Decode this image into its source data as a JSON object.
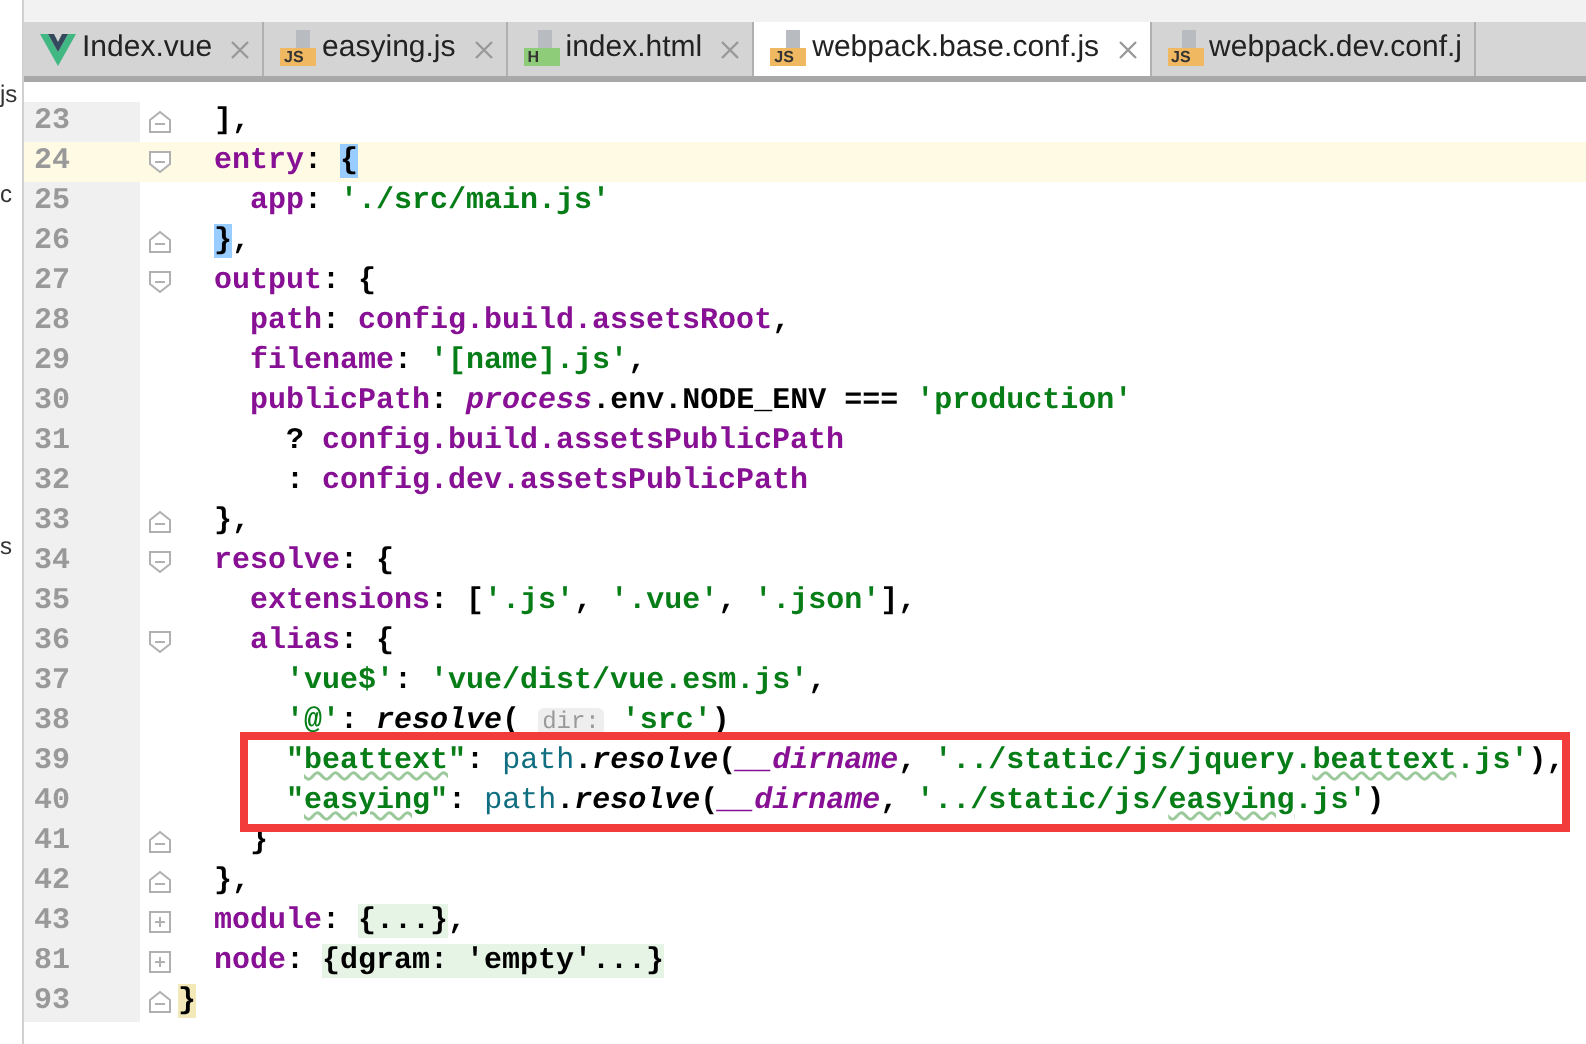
{
  "side_panel": {
    "fragments": [
      "js",
      "c",
      "s"
    ]
  },
  "tabs": [
    {
      "label": "Index.vue",
      "kind": "component",
      "selected": false,
      "closable": true
    },
    {
      "label": "easying.js",
      "kind": "script",
      "badge": "JS",
      "selected": false,
      "closable": true
    },
    {
      "label": "index.html",
      "kind": "markup",
      "badge": "H",
      "selected": false,
      "closable": true
    },
    {
      "label": "webpack.base.conf.js",
      "kind": "script",
      "badge": "JS",
      "selected": true,
      "closable": true
    },
    {
      "label": "webpack.dev.conf.j",
      "kind": "script",
      "badge": "JS",
      "selected": false,
      "closable": false
    }
  ],
  "editor": {
    "lines": [
      {
        "number": "23",
        "kind": "closer",
        "current": false,
        "boxed": false,
        "tokens": [
          {
            "kind": "punct",
            "text": "  ],"
          }
        ]
      },
      {
        "number": "24",
        "kind": "opener",
        "current": true,
        "boxed": false,
        "tokens": [
          {
            "kind": "prop",
            "text": "  entry"
          },
          {
            "kind": "punct",
            "text": ": "
          },
          {
            "kind": "match",
            "text": "{"
          }
        ]
      },
      {
        "number": "25",
        "kind": "plain",
        "current": false,
        "boxed": false,
        "tokens": [
          {
            "kind": "prop",
            "text": "    app"
          },
          {
            "kind": "punct",
            "text": ": "
          },
          {
            "kind": "str",
            "text": "'./src/main.js'"
          }
        ]
      },
      {
        "number": "26",
        "kind": "closer",
        "current": false,
        "boxed": false,
        "tokens": [
          {
            "kind": "match",
            "text": "  }"
          },
          {
            "kind": "punct",
            "text": ","
          }
        ]
      },
      {
        "number": "27",
        "kind": "opener",
        "current": false,
        "boxed": false,
        "tokens": [
          {
            "kind": "prop",
            "text": "  output"
          },
          {
            "kind": "punct",
            "text": ": {"
          }
        ]
      },
      {
        "number": "28",
        "kind": "plain",
        "current": false,
        "boxed": false,
        "tokens": [
          {
            "kind": "prop",
            "text": "    path"
          },
          {
            "kind": "punct",
            "text": ": "
          },
          {
            "kind": "ident",
            "text": "config.build.assetsRoot"
          },
          {
            "kind": "punct",
            "text": ","
          }
        ]
      },
      {
        "number": "29",
        "kind": "plain",
        "current": false,
        "boxed": false,
        "tokens": [
          {
            "kind": "prop",
            "text": "    filename"
          },
          {
            "kind": "punct",
            "text": ": "
          },
          {
            "kind": "str",
            "text": "'[name].js'"
          },
          {
            "kind": "punct",
            "text": ","
          }
        ]
      },
      {
        "number": "30",
        "kind": "plain",
        "current": false,
        "boxed": false,
        "tokens": [
          {
            "kind": "prop",
            "text": "    publicPath"
          },
          {
            "kind": "punct",
            "text": ": "
          },
          {
            "kind": "italic",
            "text": "process"
          },
          {
            "kind": "punct",
            "text": ".env.NODE_ENV === "
          },
          {
            "kind": "str",
            "text": "'production'"
          }
        ]
      },
      {
        "number": "31",
        "kind": "plain",
        "current": false,
        "boxed": false,
        "tokens": [
          {
            "kind": "punct",
            "text": "      ? "
          },
          {
            "kind": "ident",
            "text": "config.build.assetsPublicPath"
          }
        ]
      },
      {
        "number": "32",
        "kind": "plain",
        "current": false,
        "boxed": false,
        "tokens": [
          {
            "kind": "punct",
            "text": "      : "
          },
          {
            "kind": "ident",
            "text": "config.dev.assetsPublicPath"
          }
        ]
      },
      {
        "number": "33",
        "kind": "closer",
        "current": false,
        "boxed": false,
        "tokens": [
          {
            "kind": "punct",
            "text": "  },"
          }
        ]
      },
      {
        "number": "34",
        "kind": "opener",
        "current": false,
        "boxed": false,
        "tokens": [
          {
            "kind": "prop",
            "text": "  resolve"
          },
          {
            "kind": "punct",
            "text": ": {"
          }
        ]
      },
      {
        "number": "35",
        "kind": "plain",
        "current": false,
        "boxed": false,
        "tokens": [
          {
            "kind": "prop",
            "text": "    extensions"
          },
          {
            "kind": "punct",
            "text": ": ["
          },
          {
            "kind": "str",
            "text": "'.js'"
          },
          {
            "kind": "punct",
            "text": ", "
          },
          {
            "kind": "str",
            "text": "'.vue'"
          },
          {
            "kind": "punct",
            "text": ", "
          },
          {
            "kind": "str",
            "text": "'.json'"
          },
          {
            "kind": "punct",
            "text": "],"
          }
        ]
      },
      {
        "number": "36",
        "kind": "opener",
        "current": false,
        "boxed": false,
        "tokens": [
          {
            "kind": "prop",
            "text": "    alias"
          },
          {
            "kind": "punct",
            "text": ": {"
          }
        ]
      },
      {
        "number": "37",
        "kind": "plain",
        "current": false,
        "boxed": false,
        "tokens": [
          {
            "kind": "str",
            "text": "      'vue$'"
          },
          {
            "kind": "punct",
            "text": ": "
          },
          {
            "kind": "str",
            "text": "'vue/dist/vue.esm.js'"
          },
          {
            "kind": "punct",
            "text": ","
          }
        ]
      },
      {
        "number": "38",
        "kind": "plain",
        "current": false,
        "boxed": false,
        "tokens": [
          {
            "kind": "str",
            "text": "      '@'"
          },
          {
            "kind": "punct",
            "text": ": "
          },
          {
            "kind": "fn",
            "text": "resolve"
          },
          {
            "kind": "punct",
            "text": "( "
          },
          {
            "kind": "hint",
            "text": "dir:"
          },
          {
            "kind": "str",
            "text": " 'src'"
          },
          {
            "kind": "punct",
            "text": ")"
          }
        ]
      },
      {
        "number": "39",
        "kind": "plain",
        "current": false,
        "boxed": true,
        "tokens": [
          {
            "kind": "str",
            "text": "      \""
          },
          {
            "kind": "typo",
            "text": "beattext"
          },
          {
            "kind": "str",
            "text": "\""
          },
          {
            "kind": "punct",
            "text": ": "
          },
          {
            "kind": "obj",
            "text": "path"
          },
          {
            "kind": "punct",
            "text": "."
          },
          {
            "kind": "fn",
            "text": "resolve"
          },
          {
            "kind": "punct",
            "text": "("
          },
          {
            "kind": "italic",
            "text": "__dirname"
          },
          {
            "kind": "punct",
            "text": ", "
          },
          {
            "kind": "str",
            "text": "'../static/js/jquery."
          },
          {
            "kind": "typo",
            "text": "beattext"
          },
          {
            "kind": "str",
            "text": ".js'"
          },
          {
            "kind": "punct",
            "text": "),"
          }
        ]
      },
      {
        "number": "40",
        "kind": "plain",
        "current": false,
        "boxed": true,
        "tokens": [
          {
            "kind": "str",
            "text": "      \""
          },
          {
            "kind": "typo",
            "text": "easying"
          },
          {
            "kind": "str",
            "text": "\""
          },
          {
            "kind": "punct",
            "text": ": "
          },
          {
            "kind": "obj",
            "text": "path"
          },
          {
            "kind": "punct",
            "text": "."
          },
          {
            "kind": "fn",
            "text": "resolve"
          },
          {
            "kind": "punct",
            "text": "("
          },
          {
            "kind": "italic",
            "text": "__dirname"
          },
          {
            "kind": "punct",
            "text": ", "
          },
          {
            "kind": "str",
            "text": "'../static/js/"
          },
          {
            "kind": "typo",
            "text": "easying"
          },
          {
            "kind": "str",
            "text": ".js'"
          },
          {
            "kind": "punct",
            "text": ")"
          }
        ]
      },
      {
        "number": "41",
        "kind": "closer",
        "current": false,
        "boxed": false,
        "tokens": [
          {
            "kind": "punct",
            "text": "    }"
          }
        ]
      },
      {
        "number": "42",
        "kind": "closer",
        "current": false,
        "boxed": false,
        "tokens": [
          {
            "kind": "punct",
            "text": "  },"
          }
        ]
      },
      {
        "number": "43",
        "kind": "folded",
        "current": false,
        "boxed": false,
        "tokens": [
          {
            "kind": "prop",
            "text": "  module"
          },
          {
            "kind": "punct",
            "text": ": "
          },
          {
            "kind": "folded",
            "text": "{...}"
          },
          {
            "kind": "punct",
            "text": ","
          }
        ]
      },
      {
        "number": "81",
        "kind": "folded",
        "current": false,
        "boxed": false,
        "tokens": [
          {
            "kind": "prop",
            "text": "  node"
          },
          {
            "kind": "punct",
            "text": ": "
          },
          {
            "kind": "folded",
            "text": "{dgram: 'empty'...}"
          }
        ]
      },
      {
        "number": "93",
        "kind": "closer",
        "current": false,
        "boxed": false,
        "tokens": [
          {
            "kind": "bracket",
            "text": "}"
          }
        ]
      }
    ]
  }
}
